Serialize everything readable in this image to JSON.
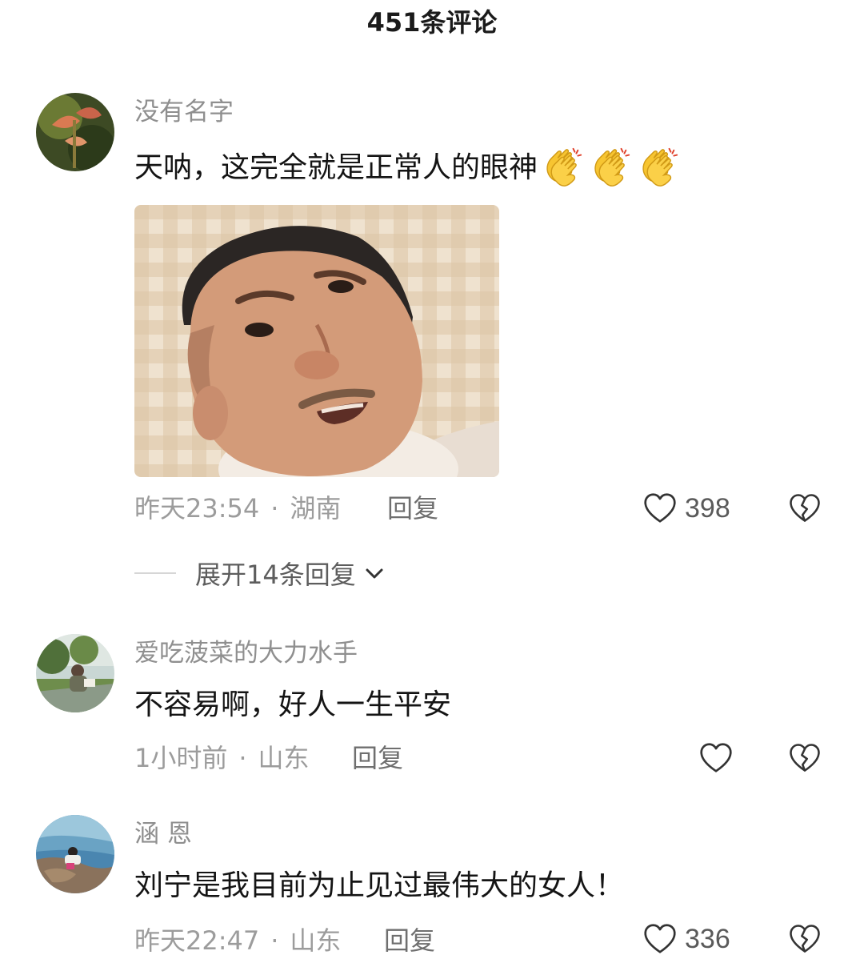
{
  "header": {
    "title": "451条评论"
  },
  "comments": [
    {
      "username": "没有名字",
      "text": "天呐，这完全就是正常人的眼神",
      "emoji": "clapping-hands",
      "time": "昨天23:54",
      "location": "湖南",
      "reply_label": "回复",
      "likes": "398",
      "expand_label": "展开14条回复"
    },
    {
      "username": "爱吃菠菜的大力水手",
      "text": "不容易啊，好人一生平安",
      "time": "1小时前",
      "location": "山东",
      "reply_label": "回复",
      "likes": ""
    },
    {
      "username": "涵 恩",
      "text": "刘宁是我目前为止见过最伟大的女人！",
      "time": "昨天22:47",
      "location": "山东",
      "reply_label": "回复",
      "likes": "336"
    }
  ],
  "icons": {
    "like": "heart-outline-icon",
    "dislike": "broken-heart-icon",
    "expand": "chevron-down-icon"
  },
  "colors": {
    "username": "#8f8f8f",
    "meta": "#9c9c9c",
    "emoji": "#f7c531"
  }
}
